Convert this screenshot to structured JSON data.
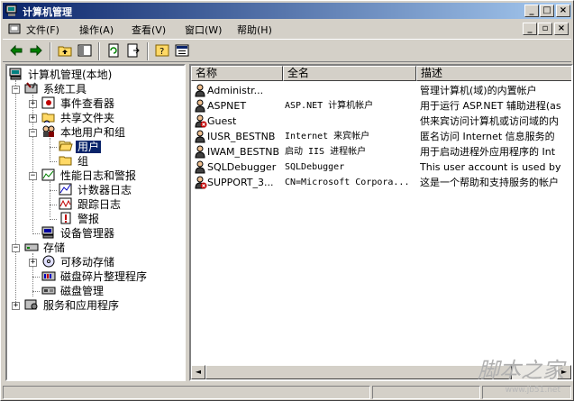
{
  "window": {
    "title": "计算机管理",
    "minimize": "_",
    "maximize": "□",
    "close": "×",
    "mdi_minimize": "_",
    "mdi_restore": "▫",
    "mdi_close": "×"
  },
  "menu": {
    "items": [
      "文件(F)",
      "操作(A)",
      "查看(V)",
      "窗口(W)",
      "帮助(H)"
    ]
  },
  "tree": {
    "root": "计算机管理(本地)",
    "system_tools": "系统工具",
    "event_viewer": "事件查看器",
    "shared_folders": "共享文件夹",
    "local_users": "本地用户和组",
    "users": "用户",
    "groups": "组",
    "perf_logs": "性能日志和警报",
    "counter_logs": "计数器日志",
    "trace_logs": "跟踪日志",
    "alerts": "警报",
    "device_manager": "设备管理器",
    "storage": "存储",
    "removable_storage": "可移动存储",
    "defrag": "磁盘碎片整理程序",
    "disk_mgmt": "磁盘管理",
    "services_apps": "服务和应用程序"
  },
  "list": {
    "columns": [
      "名称",
      "全名",
      "描述"
    ],
    "rows": [
      {
        "name": "Administr...",
        "full": "",
        "desc": "管理计算机(域)的内置帐户",
        "disabled": false
      },
      {
        "name": "ASPNET",
        "full": "ASP.NET 计算机帐户",
        "desc": "用于运行 ASP.NET 辅助进程(as",
        "disabled": false
      },
      {
        "name": "Guest",
        "full": "",
        "desc": "供来宾访问计算机或访问域的内",
        "disabled": true
      },
      {
        "name": "IUSR_BESTNB",
        "full": "Internet 来宾帐户",
        "desc": "匿名访问 Internet 信息服务的",
        "disabled": false
      },
      {
        "name": "IWAM_BESTNB",
        "full": "启动 IIS 进程帐户",
        "desc": "用于启动进程外应用程序的 Int",
        "disabled": false
      },
      {
        "name": "SQLDebugger",
        "full": "SQLDebugger",
        "desc": "This user account is used by",
        "disabled": false
      },
      {
        "name": "SUPPORT_3...",
        "full": "CN=Microsoft Corpora...",
        "desc": "这是一个帮助和支持服务的帐户",
        "disabled": true
      }
    ]
  },
  "scroll": {
    "left": "◄",
    "right": "►"
  },
  "watermark": {
    "main": "脚本之家",
    "sub": "www.jb51.net"
  },
  "colors": {
    "selection": "#0a246a",
    "title_start": "#0a246a",
    "title_end": "#a6caf0"
  }
}
